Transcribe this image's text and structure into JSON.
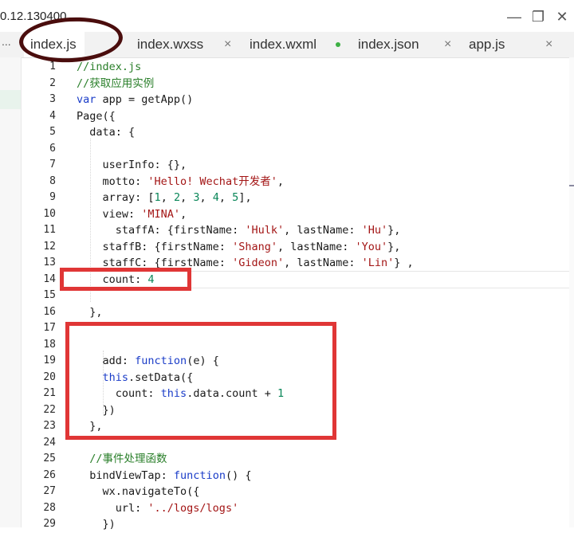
{
  "window": {
    "title": "0.12.130400",
    "controls": {
      "minimize": "—",
      "maximize": "❐",
      "close": "✕"
    }
  },
  "tabs": [
    {
      "label": "index.js",
      "active": true,
      "close": ""
    },
    {
      "label": "index.wxss",
      "active": false,
      "close": "×"
    },
    {
      "label": "index.wxml",
      "active": false,
      "close": ""
    },
    {
      "label": "index.json",
      "active": false,
      "close": "×"
    },
    {
      "label": "app.js",
      "active": false,
      "close": "×"
    }
  ],
  "sidebar": {
    "ellipsis": "..."
  },
  "editor": {
    "current_line": 14,
    "lines": [
      {
        "n": "1",
        "parts": [
          [
            "cmt",
            "//index.js"
          ]
        ]
      },
      {
        "n": "2",
        "parts": [
          [
            "cmt",
            "//获取应用实例"
          ]
        ]
      },
      {
        "n": "3",
        "parts": [
          [
            "kw",
            "var"
          ],
          [
            "",
            " app = getApp()"
          ]
        ]
      },
      {
        "n": "4",
        "parts": [
          [
            "",
            "Page({"
          ]
        ]
      },
      {
        "n": "5",
        "parts": [
          [
            "",
            "  data: {"
          ]
        ]
      },
      {
        "n": "6",
        "parts": [
          [
            "",
            ""
          ]
        ]
      },
      {
        "n": "7",
        "parts": [
          [
            "",
            "    userInfo: {},"
          ]
        ]
      },
      {
        "n": "8",
        "parts": [
          [
            "",
            "    motto: "
          ],
          [
            "str",
            "'Hello! Wechat开发者'"
          ],
          [
            "",
            ","
          ]
        ]
      },
      {
        "n": "9",
        "parts": [
          [
            "",
            "    array: ["
          ],
          [
            "num",
            "1"
          ],
          [
            "",
            ", "
          ],
          [
            "num",
            "2"
          ],
          [
            "",
            ", "
          ],
          [
            "num",
            "3"
          ],
          [
            "",
            ", "
          ],
          [
            "num",
            "4"
          ],
          [
            "",
            ", "
          ],
          [
            "num",
            "5"
          ],
          [
            "",
            "],"
          ]
        ]
      },
      {
        "n": "10",
        "parts": [
          [
            "",
            "    view: "
          ],
          [
            "str",
            "'MINA'"
          ],
          [
            "",
            ","
          ]
        ]
      },
      {
        "n": "11",
        "parts": [
          [
            "",
            "      staffA: {firstName: "
          ],
          [
            "str",
            "'Hulk'"
          ],
          [
            "",
            ", lastName: "
          ],
          [
            "str",
            "'Hu'"
          ],
          [
            "",
            "},"
          ]
        ]
      },
      {
        "n": "12",
        "parts": [
          [
            "",
            "    staffB: {firstName: "
          ],
          [
            "str",
            "'Shang'"
          ],
          [
            "",
            ", lastName: "
          ],
          [
            "str",
            "'You'"
          ],
          [
            "",
            "},"
          ]
        ]
      },
      {
        "n": "13",
        "parts": [
          [
            "",
            "    staffC: {firstName: "
          ],
          [
            "str",
            "'Gideon'"
          ],
          [
            "",
            ", lastName: "
          ],
          [
            "str",
            "'Lin'"
          ],
          [
            "",
            "} ,"
          ]
        ]
      },
      {
        "n": "14",
        "parts": [
          [
            "",
            "    count: "
          ],
          [
            "num",
            "4"
          ]
        ]
      },
      {
        "n": "15",
        "parts": [
          [
            "",
            ""
          ]
        ]
      },
      {
        "n": "16",
        "parts": [
          [
            "",
            "  },"
          ]
        ]
      },
      {
        "n": "17",
        "parts": [
          [
            "",
            ""
          ]
        ]
      },
      {
        "n": "18",
        "parts": [
          [
            "",
            ""
          ]
        ]
      },
      {
        "n": "19",
        "parts": [
          [
            "",
            "    add: "
          ],
          [
            "kw",
            "function"
          ],
          [
            "",
            "(e) {"
          ]
        ]
      },
      {
        "n": "20",
        "parts": [
          [
            "",
            "    "
          ],
          [
            "kw",
            "this"
          ],
          [
            "",
            ".setData({"
          ]
        ]
      },
      {
        "n": "21",
        "parts": [
          [
            "",
            "      count: "
          ],
          [
            "kw",
            "this"
          ],
          [
            "",
            ".data.count + "
          ],
          [
            "num",
            "1"
          ]
        ]
      },
      {
        "n": "22",
        "parts": [
          [
            "",
            "    })"
          ]
        ]
      },
      {
        "n": "23",
        "parts": [
          [
            "",
            "  },"
          ]
        ]
      },
      {
        "n": "24",
        "parts": [
          [
            "",
            ""
          ]
        ]
      },
      {
        "n": "25",
        "parts": [
          [
            "",
            "  "
          ],
          [
            "cmt",
            "//事件处理函数"
          ]
        ]
      },
      {
        "n": "26",
        "parts": [
          [
            "",
            "  bindViewTap: "
          ],
          [
            "kw",
            "function"
          ],
          [
            "",
            "() {"
          ]
        ]
      },
      {
        "n": "27",
        "parts": [
          [
            "",
            "    wx.navigateTo({"
          ]
        ]
      },
      {
        "n": "28",
        "parts": [
          [
            "",
            "      url: "
          ],
          [
            "str",
            "'../logs/logs'"
          ]
        ]
      },
      {
        "n": "29",
        "parts": [
          [
            "",
            "    })"
          ]
        ]
      }
    ]
  },
  "colors": {
    "accent_circle": "#4a0d0d",
    "annotation_red": "#e03636",
    "modified_dot": "#3cb043"
  }
}
